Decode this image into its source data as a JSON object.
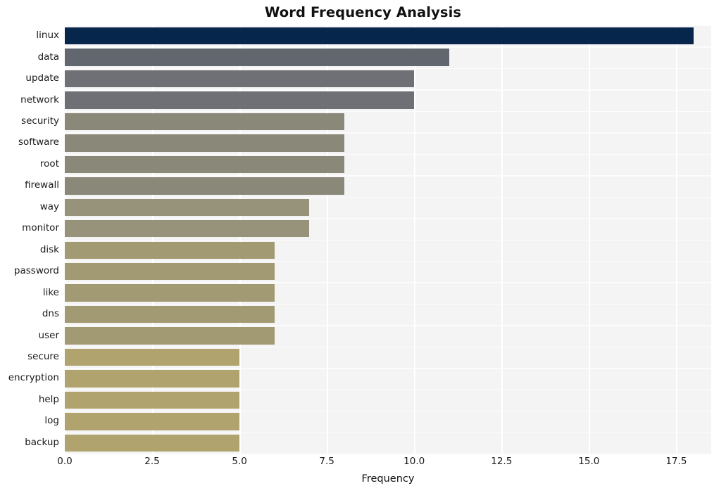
{
  "chart_data": {
    "type": "bar",
    "orientation": "horizontal",
    "title": "Word Frequency Analysis",
    "xlabel": "Frequency",
    "ylabel": "",
    "xlim": [
      0.0,
      18.5
    ],
    "grid": true,
    "legend": null,
    "xticks": [
      "0.0",
      "2.5",
      "5.0",
      "7.5",
      "10.0",
      "12.5",
      "15.0",
      "17.5"
    ],
    "xtick_values": [
      0.0,
      2.5,
      5.0,
      7.5,
      10.0,
      12.5,
      15.0,
      17.5
    ],
    "categories": [
      "linux",
      "data",
      "update",
      "network",
      "security",
      "software",
      "root",
      "firewall",
      "way",
      "monitor",
      "disk",
      "password",
      "like",
      "dns",
      "user",
      "secure",
      "encryption",
      "help",
      "log",
      "backup"
    ],
    "values": [
      18,
      11,
      10,
      10,
      8,
      8,
      8,
      8,
      7,
      7,
      6,
      6,
      6,
      6,
      6,
      5,
      5,
      5,
      5,
      5
    ],
    "bar_colors": [
      "#07264b",
      "#62676f",
      "#6e7076",
      "#6e7076",
      "#8a8878",
      "#8a8878",
      "#8a8878",
      "#8a8878",
      "#97927a",
      "#97927a",
      "#a29a73",
      "#a29a73",
      "#a29a73",
      "#a29a73",
      "#a29a73",
      "#b0a36d",
      "#b0a36d",
      "#b0a36d",
      "#b0a36d",
      "#b0a36d"
    ]
  },
  "style": {
    "plot_background": "#f4f4f5",
    "figure_background": "#ffffff",
    "gridline_color": "#ffffff",
    "text_color": "#1a1a1a"
  }
}
